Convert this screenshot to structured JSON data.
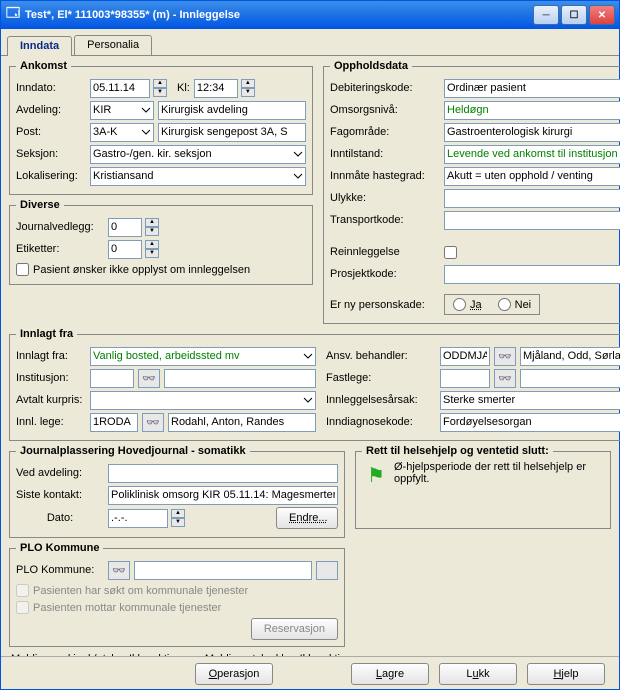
{
  "window_title": "Test*, El* 111003*98355* (m) - Innleggelse",
  "tabs": {
    "inndata": "Inndata",
    "personalia": "Personalia"
  },
  "ankomst": {
    "legend": "Ankomst",
    "inndato_lbl": "Inndato:",
    "inndato": "05.11.14",
    "kl_lbl": "Kl:",
    "kl": "12:34",
    "avdeling_lbl": "Avdeling:",
    "avdeling": "KIR",
    "avdeling_navn": "Kirurgisk avdeling",
    "post_lbl": "Post:",
    "post": "3A-K",
    "post_navn": "Kirurgisk sengepost 3A, S",
    "seksjon_lbl": "Seksjon:",
    "seksjon": "Gastro-/gen. kir. seksjon",
    "lokalisering_lbl": "Lokalisering:",
    "lokalisering": "Kristiansand"
  },
  "diverse": {
    "legend": "Diverse",
    "journalvedlegg_lbl": "Journalvedlegg:",
    "journalvedlegg": "0",
    "etiketter_lbl": "Etiketter:",
    "etiketter": "0",
    "opplyst": "Pasient ønsker ikke opplyst om innleggelsen"
  },
  "opphold": {
    "legend": "Oppholdsdata",
    "debiteringskode_lbl": "Debiteringskode:",
    "debiteringskode": "Ordinær pasient",
    "omsorgsniva_lbl": "Omsorgsnivå:",
    "omsorgsniva": "Heldøgn",
    "fagomrade_lbl": "Fagområde:",
    "fagomrade": "Gastroenterologisk kirurgi",
    "inntilstand_lbl": "Inntilstand:",
    "inntilstand": "Levende ved ankomst til institusjon",
    "innmate_lbl": "Innmåte hastegrad:",
    "innmate": "Akutt = uten opphold / venting",
    "ulykke_lbl": "Ulykke:",
    "transportkode_lbl": "Transportkode:",
    "reinnleggelse_lbl": "Reinnleggelse",
    "prosjektkode_lbl": "Prosjektkode:",
    "personskade_lbl": "Er ny personskade:",
    "ja": "Ja",
    "nei": "Nei"
  },
  "innlagt": {
    "legend": "Innlagt fra",
    "innlagt_fra_lbl": "Innlagt fra:",
    "innlagt_fra": "Vanlig bosted, arbeidssted mv",
    "institusjon_lbl": "Institusjon:",
    "avtalt_lbl": "Avtalt kurpris:",
    "innl_lege_lbl": "Innl. lege:",
    "innl_lege_kode": "1RODA",
    "innl_lege_navn": "Rodahl, Anton, Randes",
    "ansv_lbl": "Ansv. behandler:",
    "ansv_kode": "ODDMJA",
    "ansv_navn": "Mjåland, Odd, Sørlandet S",
    "fastlege_lbl": "Fastlege:",
    "arsak_lbl": "Innleggelsesårsak:",
    "arsak": "Sterke smerter",
    "diag_lbl": "Inndiagnosekode:",
    "diag": "Fordøyelsesorgan"
  },
  "journal": {
    "legend": "Journalplassering Hovedjournal - somatikk",
    "ved_avdeling_lbl": "Ved avdeling:",
    "siste_kontakt_lbl": "Siste kontakt:",
    "siste_kontakt": "Poliklinisk omsorg KIR 05.11.14: Magesmerter",
    "dato_lbl": "Dato:",
    "dato": ".-.-.",
    "endre": "Endre..."
  },
  "rett": {
    "legend": "Rett til helsehjelp og ventetid slutt:",
    "text": "Ø-hjelpsperiode der rett til helsehjelp er oppfylt."
  },
  "plo": {
    "legend": "PLO Kommune",
    "kommune_lbl": "PLO Kommune:",
    "sokt": "Pasienten har søkt om kommunale tjenester",
    "mottar": "Pasienten mottar kommunale tjenester",
    "reservasjon": "Reservasjon"
  },
  "status": {
    "innl": "Melding ved innl./utskr.: Ikke aktiv",
    "klar": "Melding utskr. klar: Ikke aktiv"
  },
  "buttons": {
    "operasjon": "Operasjon",
    "lagre": "Lagre",
    "lukk": "Lukk",
    "hjelp": "Hjelp"
  }
}
